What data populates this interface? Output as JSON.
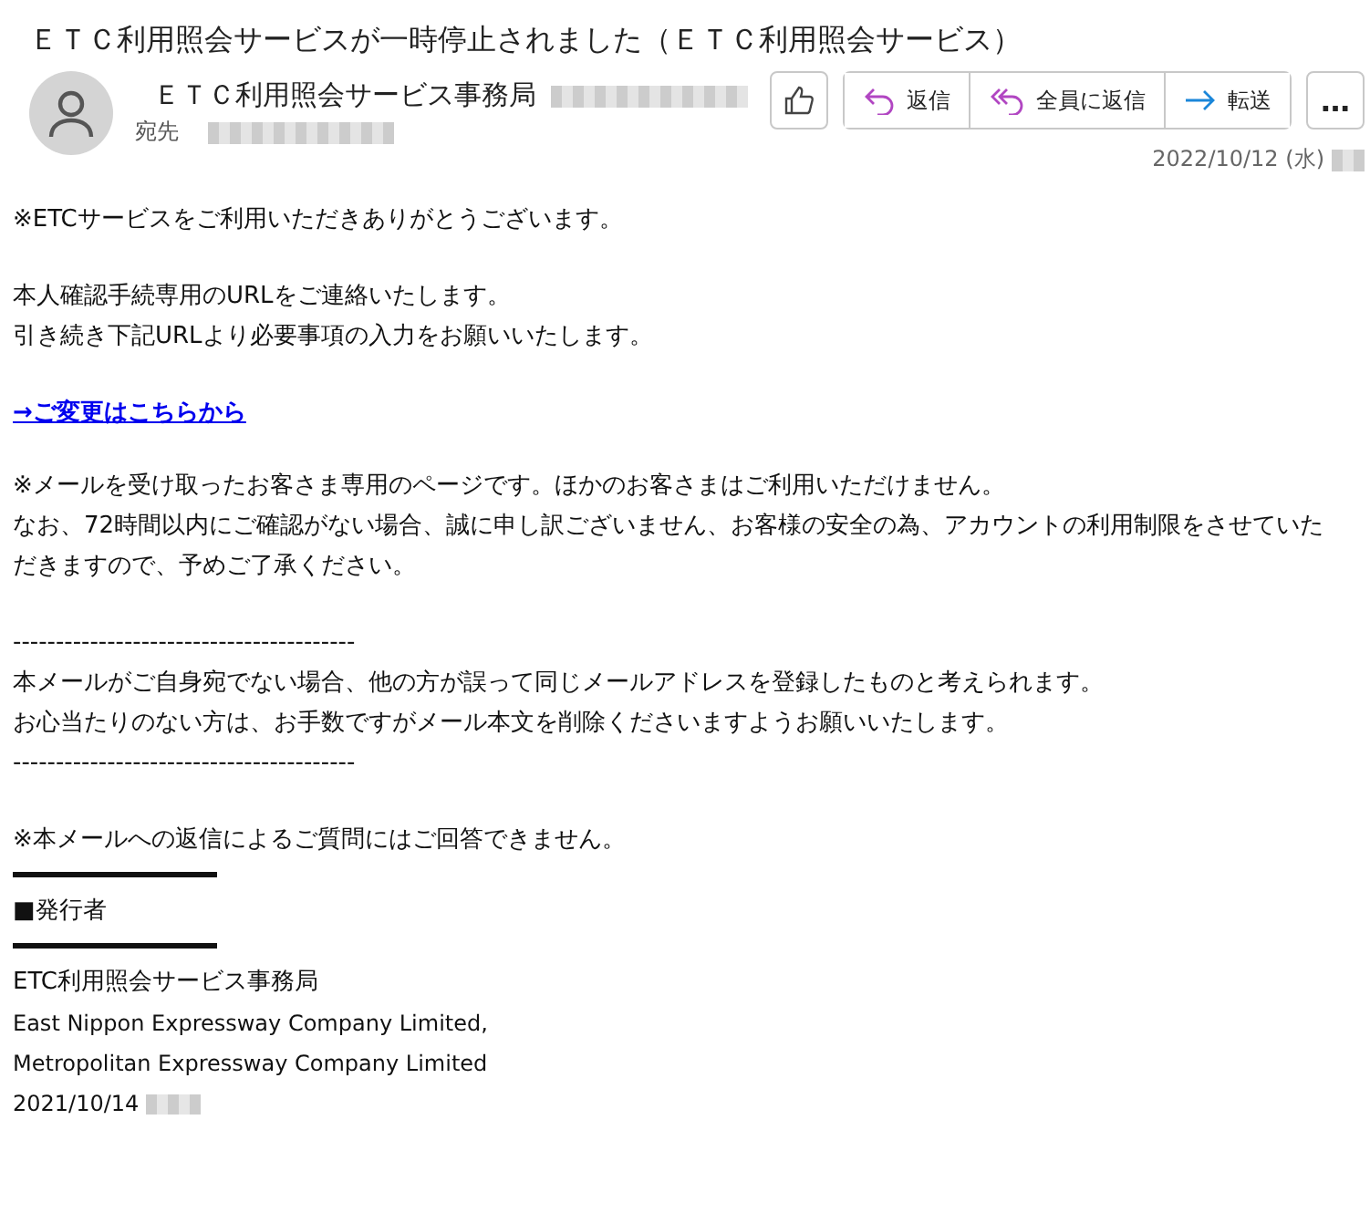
{
  "subject": "ＥＴＣ利用照会サービスが一時停止されました（ＥＴＣ利用照会サービス）",
  "sender": {
    "name": "ＥＴＣ利用照会サービス事務局",
    "to_label": "宛先",
    "date": "2022/10/12 (水)"
  },
  "actions": [
    {
      "kind": "like"
    },
    {
      "kind": "reply",
      "label": "返信"
    },
    {
      "kind": "reply_all",
      "label": "全員に返信"
    },
    {
      "kind": "forward",
      "label": "転送"
    },
    {
      "kind": "more",
      "label": "…"
    }
  ],
  "body": [
    {
      "kind": "paragraph",
      "lines": [
        "※ETCサービスをご利用いただきありがとうございます。"
      ]
    },
    {
      "kind": "paragraph",
      "lines": [
        "本人確認手続専用のURLをご連絡いたします。",
        "引き続き下記URLより必要事項の入力をお願いいたします。"
      ]
    },
    {
      "kind": "link",
      "text": "→ご変更はこちらから"
    },
    {
      "kind": "paragraph",
      "lines": [
        "※メールを受け取ったお客さま専用のページです。ほかのお客さまはご利用いただけません。",
        "なお、72時間以内にご確認がない場合、誠に申し訳ございません、お客様の安全の為、アカウントの利用制限をさせていただきますので、予めご了承ください。"
      ]
    },
    {
      "kind": "paragraph",
      "lines": [
        "----------------------------------------",
        "本メールがご自身宛でない場合、他の方が誤って同じメールアドレスを登録したものと考えられます。",
        "お心当たりのない方は、お手数ですがメール本文を削除くださいますようお願いいたします。",
        "----------------------------------------"
      ]
    },
    {
      "kind": "note",
      "lines": [
        "※本メールへの返信によるご質問にはご回答できません。"
      ]
    },
    {
      "kind": "rule"
    },
    {
      "kind": "note",
      "lines": [
        "■発行者"
      ]
    },
    {
      "kind": "rule"
    },
    {
      "kind": "signature",
      "lines": [
        "ETC利用照会サービス事務局",
        "East Nippon Expressway Company Limited,",
        "Metropolitan Expressway Company Limited",
        "2021/10/14"
      ]
    }
  ]
}
